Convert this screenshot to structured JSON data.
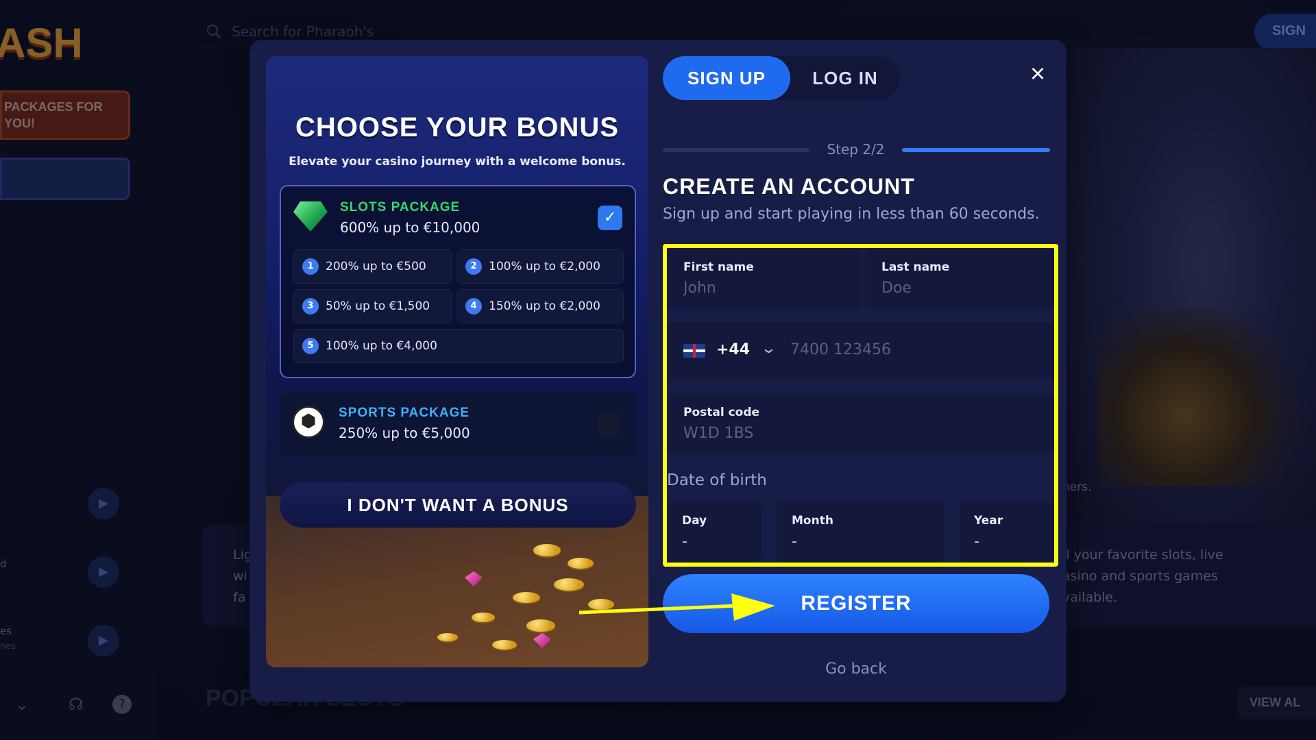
{
  "site": {
    "logo": "ASH",
    "search_placeholder": "Search for Pharaoh's",
    "sign_chip": "SIGN",
    "banner_text": "PACKAGES FOR YOU!",
    "promo_right": "ll your favorite slots, live asino and sports games vailable.",
    "promo_left": "Lig wi fa",
    "ghost_text": "ners.",
    "view_all": "VIEW AL",
    "popular_heading": "POPULAR SLOTS",
    "sidebar_text_1": "d",
    "sidebar_text_2": "es",
    "sidebar_text_3": "nes"
  },
  "bonus": {
    "title": "CHOOSE YOUR BONUS",
    "subtitle": "Elevate your casino journey with a welcome bonus.",
    "slots": {
      "name": "SLOTS PACKAGE",
      "offer": "600% up to €10,000",
      "selected": true,
      "tiers": [
        {
          "n": "1",
          "label": "200% up to €500"
        },
        {
          "n": "2",
          "label": "100% up to €2,000"
        },
        {
          "n": "3",
          "label": "50% up to €1,500"
        },
        {
          "n": "4",
          "label": "150% up to €2,000"
        },
        {
          "n": "5",
          "label": "100% up to €4,000"
        }
      ]
    },
    "sports": {
      "name": "SPORTS PACKAGE",
      "offer": "250% up to €5,000",
      "selected": false
    },
    "no_bonus": "I DON'T WANT A BONUS"
  },
  "auth": {
    "tab_signup": "SIGN UP",
    "tab_login": "LOG IN",
    "close_icon": "×",
    "step": "Step 2/2",
    "heading": "CREATE AN ACCOUNT",
    "description": "Sign up and start playing in less than 60 seconds.",
    "first_name": {
      "label": "First name",
      "placeholder": "John"
    },
    "last_name": {
      "label": "Last name",
      "placeholder": "Doe"
    },
    "phone": {
      "country_code": "+44",
      "placeholder": "7400 123456"
    },
    "postal": {
      "label": "Postal code",
      "placeholder": "W1D 1BS"
    },
    "dob": {
      "label": "Date of birth",
      "day": {
        "label": "Day",
        "value": "-"
      },
      "month": {
        "label": "Month",
        "value": "-"
      },
      "year": {
        "label": "Year",
        "value": "-"
      }
    },
    "register": "REGISTER",
    "go_back": "Go back"
  },
  "colors": {
    "accent": "#1f6bf0",
    "highlight": "#ffff11",
    "slots_green": "#35d86c",
    "sports_blue": "#3cb3ff"
  }
}
